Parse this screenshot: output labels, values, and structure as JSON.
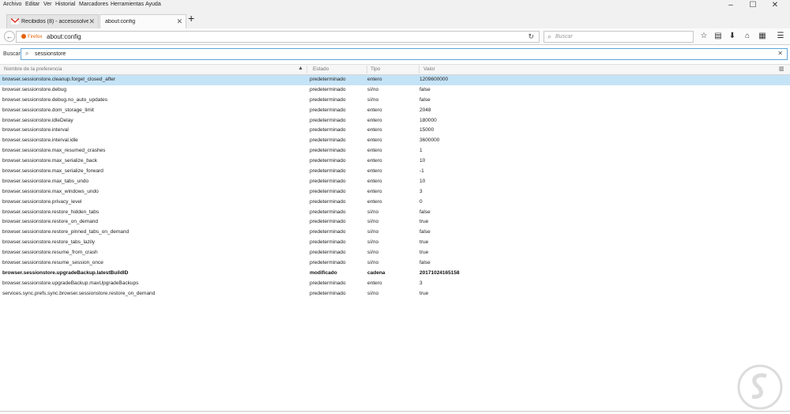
{
  "menubar": {
    "items": [
      "Archivo",
      "Editar",
      "Ver",
      "Historial",
      "Marcadores",
      "Herramientas",
      "Ayuda"
    ]
  },
  "window_controls": {
    "minimize": "–",
    "maximize": "☐",
    "close": "✕"
  },
  "tabs": [
    {
      "label": "Recibidos (8) - accesosolvete",
      "active": false,
      "icon": "gmail-icon"
    },
    {
      "label": "about:config",
      "active": true
    }
  ],
  "navbar": {
    "identity": "Firefox",
    "url": "about:config",
    "search_placeholder": "Buscar"
  },
  "filter": {
    "label": "Buscar:",
    "value": "sessionstore"
  },
  "columns": {
    "name": "Nombre de la preferencia",
    "status": "Estado",
    "type": "Tipo",
    "value": "Valor"
  },
  "rows": [
    {
      "name": "browser.sessionstore.cleanup.forget_closed_after",
      "status": "predeterminado",
      "type": "entero",
      "value": "1209600000"
    },
    {
      "name": "browser.sessionstore.debug",
      "status": "predeterminado",
      "type": "sí/no",
      "value": "false"
    },
    {
      "name": "browser.sessionstore.debug.no_auto_updates",
      "status": "predeterminado",
      "type": "sí/no",
      "value": "false"
    },
    {
      "name": "browser.sessionstore.dom_storage_limit",
      "status": "predeterminado",
      "type": "entero",
      "value": "2048"
    },
    {
      "name": "browser.sessionstore.idleDelay",
      "status": "predeterminado",
      "type": "entero",
      "value": "180000"
    },
    {
      "name": "browser.sessionstore.interval",
      "status": "predeterminado",
      "type": "entero",
      "value": "15000"
    },
    {
      "name": "browser.sessionstore.interval.idle",
      "status": "predeterminado",
      "type": "entero",
      "value": "3600000"
    },
    {
      "name": "browser.sessionstore.max_resumed_crashes",
      "status": "predeterminado",
      "type": "entero",
      "value": "1"
    },
    {
      "name": "browser.sessionstore.max_serialize_back",
      "status": "predeterminado",
      "type": "entero",
      "value": "10"
    },
    {
      "name": "browser.sessionstore.max_serialize_forward",
      "status": "predeterminado",
      "type": "entero",
      "value": "-1"
    },
    {
      "name": "browser.sessionstore.max_tabs_undo",
      "status": "predeterminado",
      "type": "entero",
      "value": "10"
    },
    {
      "name": "browser.sessionstore.max_windows_undo",
      "status": "predeterminado",
      "type": "entero",
      "value": "3"
    },
    {
      "name": "browser.sessionstore.privacy_level",
      "status": "predeterminado",
      "type": "entero",
      "value": "0"
    },
    {
      "name": "browser.sessionstore.restore_hidden_tabs",
      "status": "predeterminado",
      "type": "sí/no",
      "value": "false"
    },
    {
      "name": "browser.sessionstore.restore_on_demand",
      "status": "predeterminado",
      "type": "sí/no",
      "value": "true"
    },
    {
      "name": "browser.sessionstore.restore_pinned_tabs_on_demand",
      "status": "predeterminado",
      "type": "sí/no",
      "value": "false"
    },
    {
      "name": "browser.sessionstore.restore_tabs_lazily",
      "status": "predeterminado",
      "type": "sí/no",
      "value": "true"
    },
    {
      "name": "browser.sessionstore.resume_from_crash",
      "status": "predeterminado",
      "type": "sí/no",
      "value": "true"
    },
    {
      "name": "browser.sessionstore.resume_session_once",
      "status": "predeterminado",
      "type": "sí/no",
      "value": "false"
    },
    {
      "name": "browser.sessionstore.upgradeBackup.latestBuildID",
      "status": "modificado",
      "type": "cadena",
      "value": "20171024165158"
    },
    {
      "name": "browser.sessionstore.upgradeBackup.maxUpgradeBackups",
      "status": "predeterminado",
      "type": "entero",
      "value": "3"
    },
    {
      "name": "services.sync.prefs.sync.browser.sessionstore.restore_on_demand",
      "status": "predeterminado",
      "type": "sí/no",
      "value": "true"
    }
  ],
  "colors": {
    "selected_row": "#c5e3f6",
    "filter_focus": "#5fa5d8",
    "firefox_accent": "#e66000"
  }
}
